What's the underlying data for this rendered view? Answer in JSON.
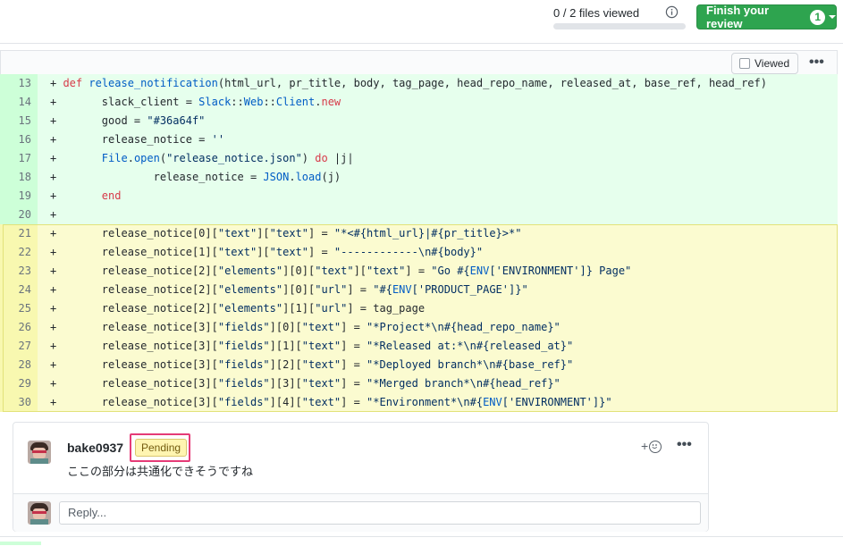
{
  "header": {
    "files_viewed": "0 / 2 files viewed",
    "finish_review_label": "Finish your review",
    "pending_count": "1"
  },
  "file_header": {
    "viewed_label": "Viewed",
    "more_label": "•••"
  },
  "diff_lines": [
    {
      "num": "13",
      "html": "+ <span class=\"kw\">def</span> <span class=\"cls\">release_notification</span>(html_url, pr_title, body, tag_page, head_repo_name, released_at, base_ref, head_ref)",
      "selected": false
    },
    {
      "num": "14",
      "html": "+       slack_client = <span class=\"cls\">Slack</span>::<span class=\"cls\">Web</span>::<span class=\"cls\">Client</span>.<span class=\"kw\">new</span>",
      "selected": false
    },
    {
      "num": "15",
      "html": "+       good = <span class=\"str\">\"#36a64f\"</span>",
      "selected": false
    },
    {
      "num": "16",
      "html": "+       release_notice = <span class=\"str\">''</span>",
      "selected": false
    },
    {
      "num": "17",
      "html": "+       <span class=\"cls\">File</span>.<span class=\"cls\">open</span>(<span class=\"str\">\"release_notice.json\"</span>) <span class=\"kw\">do</span> |j|",
      "selected": false
    },
    {
      "num": "18",
      "html": "+               release_notice = <span class=\"cls\">JSON</span>.<span class=\"cls\">load</span>(j)",
      "selected": false
    },
    {
      "num": "19",
      "html": "+       <span class=\"kw\">end</span>",
      "selected": false
    },
    {
      "num": "20",
      "html": "+",
      "selected": false
    },
    {
      "num": "21",
      "html": "+       release_notice[0][<span class=\"str\">\"text\"</span>][<span class=\"str\">\"text\"</span>] = <span class=\"str\">\"*&lt;#{html_url}|#{pr_title}&gt;*\"</span>",
      "selected": true
    },
    {
      "num": "22",
      "html": "+       release_notice[1][<span class=\"str\">\"text\"</span>][<span class=\"str\">\"text\"</span>] = <span class=\"str\">\"------------\\n#{body}\"</span>",
      "selected": true
    },
    {
      "num": "23",
      "html": "+       release_notice[2][<span class=\"str\">\"elements\"</span>][0][<span class=\"str\">\"text\"</span>][<span class=\"str\">\"text\"</span>] = <span class=\"str\">\"Go #{<span class=\"cls\">ENV</span>['ENVIRONMENT']} Page\"</span>",
      "selected": true
    },
    {
      "num": "24",
      "html": "+       release_notice[2][<span class=\"str\">\"elements\"</span>][0][<span class=\"str\">\"url\"</span>] = <span class=\"str\">\"#{<span class=\"cls\">ENV</span>['PRODUCT_PAGE']}\"</span>",
      "selected": true
    },
    {
      "num": "25",
      "html": "+       release_notice[2][<span class=\"str\">\"elements\"</span>][1][<span class=\"str\">\"url\"</span>] = tag_page",
      "selected": true
    },
    {
      "num": "26",
      "html": "+       release_notice[3][<span class=\"str\">\"fields\"</span>][0][<span class=\"str\">\"text\"</span>] = <span class=\"str\">\"*Project*\\n#{head_repo_name}\"</span>",
      "selected": true
    },
    {
      "num": "27",
      "html": "+       release_notice[3][<span class=\"str\">\"fields\"</span>][1][<span class=\"str\">\"text\"</span>] = <span class=\"str\">\"*Released at:*\\n#{released_at}\"</span>",
      "selected": true
    },
    {
      "num": "28",
      "html": "+       release_notice[3][<span class=\"str\">\"fields\"</span>][2][<span class=\"str\">\"text\"</span>] = <span class=\"str\">\"*Deployed branch*\\n#{base_ref}\"</span>",
      "selected": true
    },
    {
      "num": "29",
      "html": "+       release_notice[3][<span class=\"str\">\"fields\"</span>][3][<span class=\"str\">\"text\"</span>] = <span class=\"str\">\"*Merged branch*\\n#{head_ref}\"</span>",
      "selected": true
    },
    {
      "num": "30",
      "html": "+       release_notice[3][<span class=\"str\">\"fields\"</span>][4][<span class=\"str\">\"text\"</span>] = <span class=\"str\">\"*Environment*\\n#{<span class=\"cls\">ENV</span>['ENVIRONMENT']}\"</span>",
      "selected": true
    }
  ],
  "comment": {
    "author": "bake0937",
    "status_badge": "Pending",
    "body": "ここの部分は共通化できそうですね",
    "reaction_plus": "+",
    "more_label": "•••",
    "reply_placeholder": "Reply..."
  },
  "colors": {
    "addition_bg": "#e6ffed",
    "addition_num_bg": "#cdffd8",
    "selected_bg": "#fbfbd0",
    "finish_button": "#2ea44f",
    "highlight_box": "#e53b77"
  }
}
